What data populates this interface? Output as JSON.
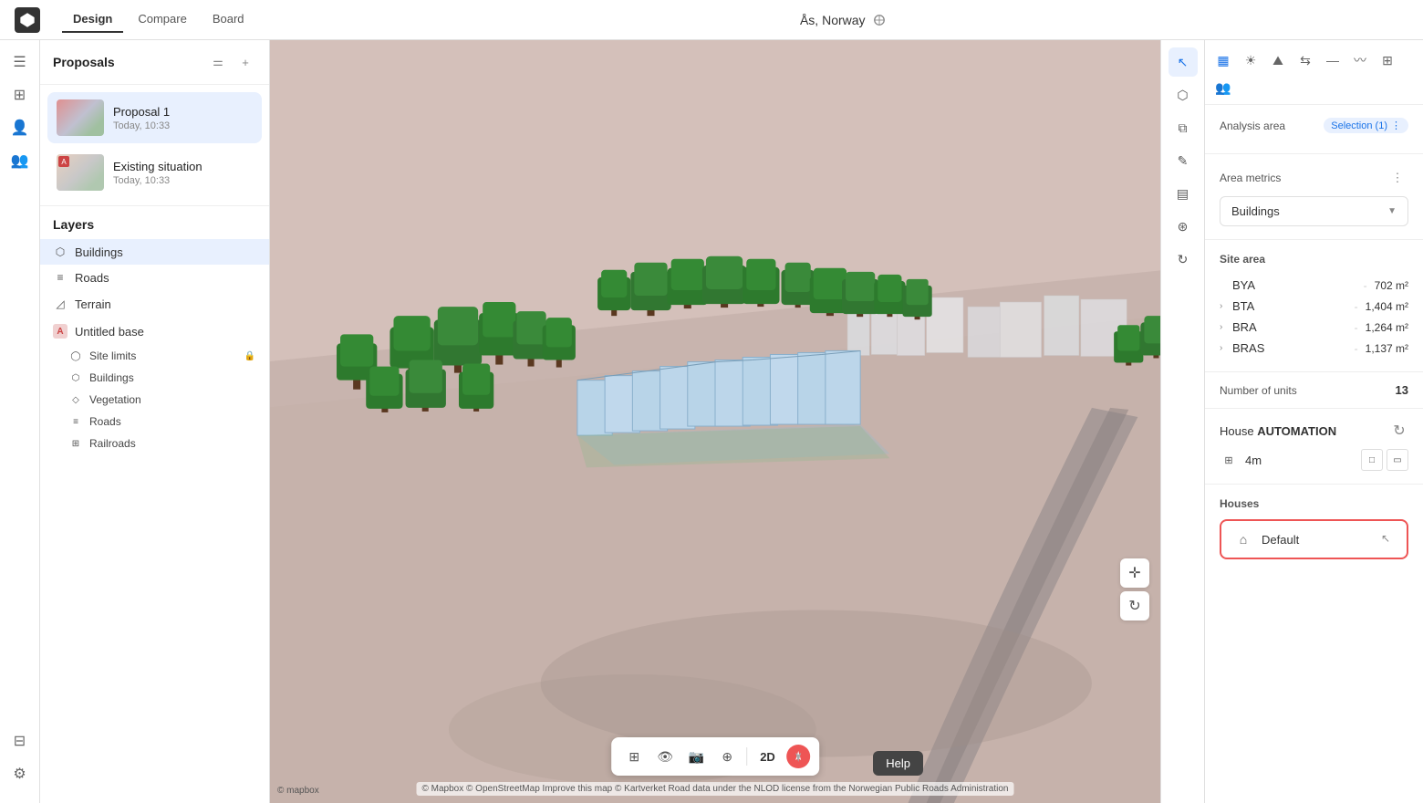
{
  "app": {
    "logo_text": "◈",
    "title": "Ås, Norway"
  },
  "nav": {
    "items": [
      {
        "id": "design",
        "label": "Design",
        "active": true
      },
      {
        "id": "compare",
        "label": "Compare",
        "active": false
      },
      {
        "id": "board",
        "label": "Board",
        "active": false
      }
    ]
  },
  "left_panel": {
    "title": "Proposals",
    "proposals": [
      {
        "id": "p1",
        "label": "Proposal 1",
        "time": "Today, 10:33",
        "active": true
      },
      {
        "id": "p2",
        "label": "Existing situation",
        "time": "Today, 10:33",
        "active": false
      }
    ],
    "layers_title": "Layers",
    "layers": [
      {
        "id": "buildings",
        "icon": "⬡",
        "label": "Buildings",
        "active": true
      },
      {
        "id": "roads",
        "icon": "≡",
        "label": "Roads",
        "active": false
      }
    ],
    "untitled_base": {
      "label": "Untitled base",
      "prefix": "A",
      "sub_layers": [
        {
          "id": "site-limits",
          "icon": "◯",
          "label": "Site limits",
          "locked": true
        },
        {
          "id": "buildings-sub",
          "icon": "⬡",
          "label": "Buildings",
          "locked": false
        },
        {
          "id": "vegetation",
          "icon": "◇",
          "label": "Vegetation",
          "locked": false
        },
        {
          "id": "roads-sub",
          "icon": "≡",
          "label": "Roads",
          "locked": false
        },
        {
          "id": "railroads",
          "icon": "⊞",
          "label": "Railroads",
          "locked": false
        }
      ]
    },
    "terrain": {
      "label": "Terrain"
    }
  },
  "map": {
    "attribution": "© Mapbox © OpenStreetMap Improve this map © Kartverket Road data under the NLOD license from the Norwegian Public Roads Administration",
    "mapbox_logo": "© mapbox"
  },
  "toolbar": {
    "items": [
      "grid-icon",
      "eye-icon",
      "camera-icon",
      "crosshair-icon"
    ],
    "mode_2d": "2D",
    "north_label": "N"
  },
  "right_panel": {
    "analysis_area_label": "Analysis area",
    "selection_label": "Selection (1)",
    "area_metrics_label": "Area metrics",
    "buildings_dropdown": "Buildings",
    "site_area_label": "Site area",
    "metrics": [
      {
        "id": "bya",
        "name": "BYA",
        "dash": "-",
        "value": "702 m²"
      },
      {
        "id": "bta",
        "name": "BTA",
        "dash": "-",
        "value": "1,404 m²",
        "expandable": true
      },
      {
        "id": "bra",
        "name": "BRA",
        "dash": "-",
        "value": "1,264 m²",
        "expandable": true
      },
      {
        "id": "bras",
        "name": "BRAS",
        "dash": "-",
        "value": "1,137 m²",
        "expandable": true
      }
    ],
    "number_of_units_label": "Number of units",
    "number_of_units_value": "13",
    "house_automation": {
      "prefix": "House",
      "suffix": "AUTOMATION",
      "height": "4m"
    },
    "houses_label": "Houses",
    "default_house_label": "Default"
  },
  "right_bar": {
    "icons": [
      {
        "id": "bar-chart",
        "symbol": "▦",
        "active": true
      },
      {
        "id": "sun",
        "symbol": "☀",
        "active": false
      },
      {
        "id": "mountain",
        "symbol": "⛰",
        "active": false
      },
      {
        "id": "arrows",
        "symbol": "⇆",
        "active": false
      },
      {
        "id": "ruler",
        "symbol": "📏",
        "active": false
      },
      {
        "id": "wave",
        "symbol": "〰",
        "active": false
      },
      {
        "id": "grid2",
        "symbol": "⊞",
        "active": false
      },
      {
        "id": "people",
        "symbol": "👥",
        "active": false
      }
    ],
    "vertical_icons": [
      {
        "id": "cursor",
        "symbol": "⊹"
      },
      {
        "id": "box3d",
        "symbol": "⬡"
      },
      {
        "id": "layers2",
        "symbol": "⧉"
      },
      {
        "id": "edit",
        "symbol": "✎"
      },
      {
        "id": "table",
        "symbol": "▤"
      },
      {
        "id": "group",
        "symbol": "⊛"
      },
      {
        "id": "plus-rotate",
        "symbol": "↻"
      }
    ]
  },
  "help_btn": "Help"
}
